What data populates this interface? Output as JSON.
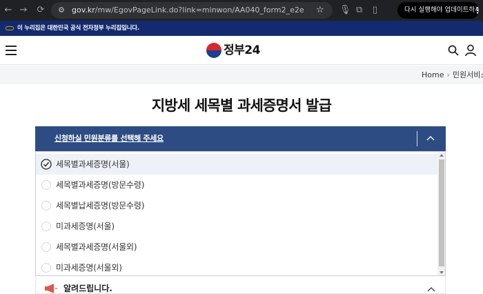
{
  "browser": {
    "url_host": "gov.kr",
    "url_path": "/mw/EgovPageLink.do?link=minwon/AA040_form2_e2e",
    "update_label": "다시 실행해야 업데이트하세요."
  },
  "notice_bar": {
    "text": "이 누리집은 대한민국 공식 전자정부 누리집입니다."
  },
  "header": {
    "logo_text": "정부24"
  },
  "breadcrumb": {
    "home": "Home",
    "current": "민원서비스"
  },
  "page": {
    "title": "지방세 세목별 과세증명서 발급"
  },
  "select": {
    "label": "신청하실 민원분류를 선택해 주세요",
    "options": [
      {
        "label": "세목별과세증명(서울)",
        "selected": true
      },
      {
        "label": "세목별과세증명(방문수령)",
        "selected": false
      },
      {
        "label": "세목별납세증명(방문수령)",
        "selected": false
      },
      {
        "label": "미과세증명(서울)",
        "selected": false
      },
      {
        "label": "세목별과세증명(서울외)",
        "selected": false
      },
      {
        "label": "미과세증명(서울외)",
        "selected": false
      }
    ]
  },
  "alert": {
    "title": "알려드립니다."
  },
  "colors": {
    "select_bar": "#2d4c84",
    "notice_bar": "#142a6e",
    "selected_row": "#eef2f8"
  }
}
